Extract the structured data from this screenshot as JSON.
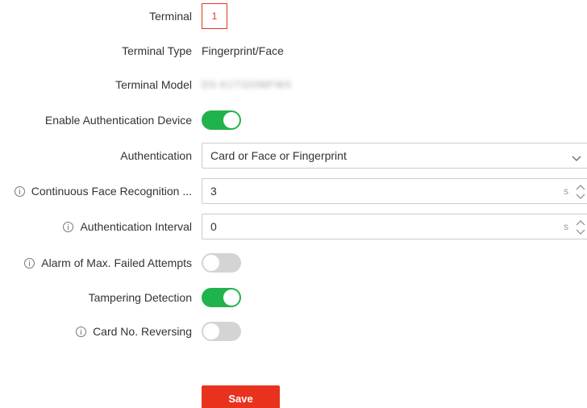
{
  "form": {
    "terminal": {
      "label": "Terminal",
      "value": "1"
    },
    "terminal_type": {
      "label": "Terminal Type",
      "value": "Fingerprint/Face"
    },
    "terminal_model": {
      "label": "Terminal Model",
      "value": "DS-K1T320MFWX"
    },
    "enable_auth_device": {
      "label": "Enable Authentication Device",
      "on": true
    },
    "authentication": {
      "label": "Authentication",
      "value": "Card or Face or Fingerprint"
    },
    "continuous_face_recognition": {
      "label": "Continuous Face Recognition ...",
      "value": "3",
      "unit": "s"
    },
    "authentication_interval": {
      "label": "Authentication Interval",
      "value": "0",
      "unit": "s"
    },
    "alarm_max_failed": {
      "label": "Alarm of Max. Failed Attempts",
      "on": false
    },
    "tampering_detection": {
      "label": "Tampering Detection",
      "on": true
    },
    "card_no_reversing": {
      "label": "Card No. Reversing",
      "on": false
    }
  },
  "actions": {
    "save_label": "Save"
  },
  "colors": {
    "accent": "#e8321e",
    "toggle_on": "#21b34b",
    "toggle_off": "#d4d4d4"
  }
}
